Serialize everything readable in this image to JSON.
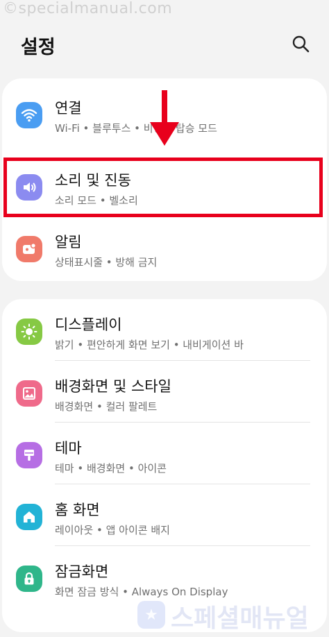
{
  "watermark": {
    "top": "©specialmanual.com",
    "bottom": "스페셜매뉴얼",
    "bottom_icon": "★"
  },
  "header": {
    "title": "설정",
    "search_icon": "search-icon"
  },
  "groups": [
    {
      "items": [
        {
          "icon": "wifi-icon",
          "color": "#4a9df2",
          "title": "연결",
          "subtitle": "Wi-Fi • 블루투스 • 비행기 탑승 모드"
        },
        {
          "icon": "speaker-icon",
          "color": "#8b8bf0",
          "title": "소리 및 진동",
          "subtitle": "소리 모드 • 벨소리",
          "highlighted": true
        },
        {
          "icon": "notification-icon",
          "color": "#f07a6a",
          "title": "알림",
          "subtitle": "상태표시줄 • 방해 금지"
        }
      ]
    },
    {
      "items": [
        {
          "icon": "sun-icon",
          "color": "#86c944",
          "title": "디스플레이",
          "subtitle": "밝기 • 편안하게 화면 보기 • 내비게이션 바"
        },
        {
          "icon": "image-icon",
          "color": "#ef6a8a",
          "title": "배경화면 및 스타일",
          "subtitle": "배경화면 • 컬러 팔레트"
        },
        {
          "icon": "brush-icon",
          "color": "#b66ee4",
          "title": "테마",
          "subtitle": "테마 • 배경화면 • 아이콘"
        },
        {
          "icon": "home-icon",
          "color": "#22b3d6",
          "title": "홈 화면",
          "subtitle": "레이아웃 • 앱 아이콘 배지"
        },
        {
          "icon": "lock-icon",
          "color": "#2fb68a",
          "title": "잠금화면",
          "subtitle": "화면 잠금 방식 • Always On Display"
        }
      ]
    }
  ],
  "annotation": {
    "color": "#e8001c"
  }
}
